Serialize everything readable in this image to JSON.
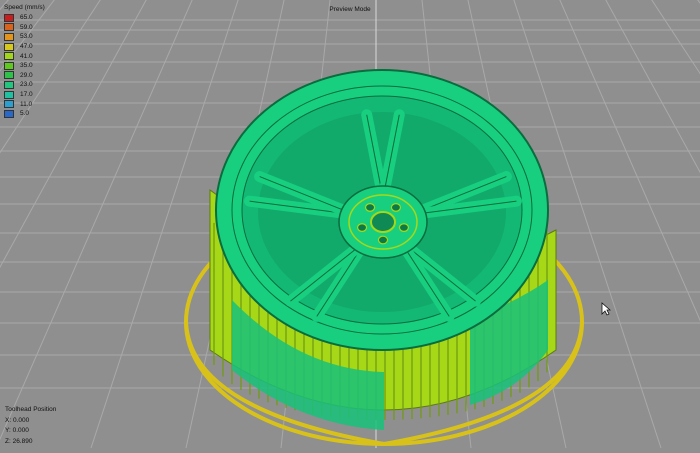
{
  "legend": {
    "title": "Speed (mm/s)",
    "items": [
      {
        "value": "65.0",
        "color": "#c81e1e"
      },
      {
        "value": "59.0",
        "color": "#d9621c"
      },
      {
        "value": "53.0",
        "color": "#e2951a"
      },
      {
        "value": "47.0",
        "color": "#d6c81c"
      },
      {
        "value": "41.0",
        "color": "#a2d61a"
      },
      {
        "value": "35.0",
        "color": "#5fca1e"
      },
      {
        "value": "29.0",
        "color": "#2ec24a"
      },
      {
        "value": "23.0",
        "color": "#22c67e"
      },
      {
        "value": "17.0",
        "color": "#20c0a2"
      },
      {
        "value": "11.0",
        "color": "#2a9fd0"
      },
      {
        "value": "5.0",
        "color": "#2868c8"
      }
    ]
  },
  "viewport": {
    "mode_label": "Preview Mode",
    "colors": {
      "background": "#8f8f8f",
      "grid": "#a9a9a9",
      "skirt": "#d8c21a",
      "model_face": "#16cf7f",
      "model_edge": "#0b7a45",
      "infill": "#a6d817"
    }
  },
  "toolhead": {
    "title": "Toolhead Position",
    "x": "X: 0.000",
    "y": "Y: 0.000",
    "z": "Z: 26.890"
  },
  "cursor_icon": "mouse-pointer-icon"
}
